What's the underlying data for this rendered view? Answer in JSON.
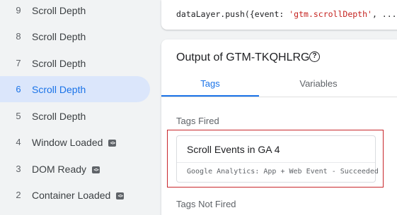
{
  "events": [
    {
      "num": "9",
      "label": "Scroll Depth",
      "has_icon": false,
      "active": false
    },
    {
      "num": "8",
      "label": "Scroll Depth",
      "has_icon": false,
      "active": false
    },
    {
      "num": "7",
      "label": "Scroll Depth",
      "has_icon": false,
      "active": false
    },
    {
      "num": "6",
      "label": "Scroll Depth",
      "has_icon": false,
      "active": true
    },
    {
      "num": "5",
      "label": "Scroll Depth",
      "has_icon": false,
      "active": false
    },
    {
      "num": "4",
      "label": "Window Loaded",
      "has_icon": true,
      "active": false
    },
    {
      "num": "3",
      "label": "DOM Ready",
      "has_icon": true,
      "active": false
    },
    {
      "num": "2",
      "label": "Container Loaded",
      "has_icon": true,
      "active": false
    }
  ],
  "event_icon": "code-icon",
  "code": {
    "prefix": "dataLayer.push({event: ",
    "string": "'gtm.scrollDepth'",
    "suffix": ", ...})"
  },
  "output": {
    "title": "Output of GTM-TKQHLRG",
    "help_icon": "help-circle-icon",
    "tabs": [
      "Tags",
      "Variables"
    ],
    "active_tab": "Tags"
  },
  "tags_fired": {
    "heading": "Tags Fired",
    "items": [
      {
        "name": "Scroll Events in GA 4",
        "status": "Google Analytics: App + Web Event - Succeeded"
      }
    ]
  },
  "tags_not_fired": {
    "heading": "Tags Not Fired"
  },
  "colors": {
    "accent": "#1a73e8",
    "active_bg": "#dbe6fb",
    "highlight": "#c8262b",
    "code_string": "#c5221f"
  }
}
